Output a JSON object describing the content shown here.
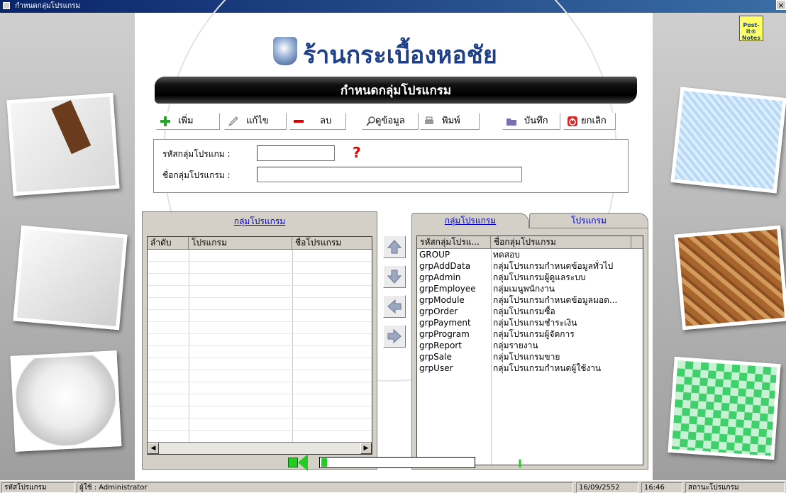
{
  "window": {
    "title": "กำหนดกลุ่มโปรแกรม",
    "close_symbol": "×"
  },
  "header": {
    "logo_text": "ร้านกระเบื้องหอชัย",
    "banner_title": "กำหนดกลุ่มโปรแกรม"
  },
  "toolbar": {
    "add_label": "เพิ่ม",
    "edit_label": "แก้ไข",
    "delete_label": "ลบ",
    "view_label": "ดูข้อมูล",
    "print_label": "พิมพ์",
    "save_label": "บันทึก",
    "cancel_label": "ยกเลิก"
  },
  "form": {
    "group_code_label": "รหัสกลุ่มโปรแกม :",
    "group_code_value": "",
    "group_name_label": "ชื่อกลุ่มโปรแกรม :",
    "group_name_value": "",
    "help_symbol": "?"
  },
  "left_panel": {
    "title": "กลุ่มโปรแกรม",
    "columns": [
      "ลำดับ",
      "โปรแกรม",
      "ชื่อโปรแกรม"
    ],
    "row_count": 16
  },
  "right_panel": {
    "tabs": [
      "กลุ่มโปรแกรม",
      "โปรแกรม"
    ],
    "columns": [
      "รหัสกลุ่มโปรแ...",
      "ชื่อกลุ่มโปรแกรม"
    ],
    "rows": [
      [
        "GROUP",
        "ทดสอบ"
      ],
      [
        "grpAddData",
        "กลุ่มโปรแกรมกำหนดข้อมูลทั่วไป"
      ],
      [
        "grpAdmin",
        "กลุ่มโปรแกรมผู้ดูแลระบบ"
      ],
      [
        "grpEmployee",
        "กลุ่มเมนูพนักงาน"
      ],
      [
        "grpModule",
        "กลุ่มโปรแกรมกำหนดข้อมูลมอด..."
      ],
      [
        "grpOrder",
        "กลุ่มโปรแกรมซื้อ"
      ],
      [
        "grpPayment",
        "กลุ่มโปรแกรมชำระเงิน"
      ],
      [
        "grpProgram",
        "กลุ่มโปรแกรมผู้จัดการ"
      ],
      [
        "grpReport",
        "กลุ่มรายงาน"
      ],
      [
        "grpSale",
        "กลุ่มโปรแกรมขาย"
      ],
      [
        "grpUser",
        "กลุ่มโปรแกรมกำหนดผู้ใช้งาน"
      ]
    ]
  },
  "postit": {
    "label": "Post-it® Notes"
  },
  "statusbar": {
    "left_text": "รหัสโปรแกรม",
    "user_text": "ผู้ใช้ : Administrator",
    "date": "16/09/2552",
    "time": "16:46",
    "status_text": "สถานะโปรแกรม"
  },
  "colors": {
    "accent": "#0000cc",
    "brand": "#1f3f86",
    "add": "#22aa22",
    "delete": "#dd0000",
    "progress": "#22cc22"
  }
}
